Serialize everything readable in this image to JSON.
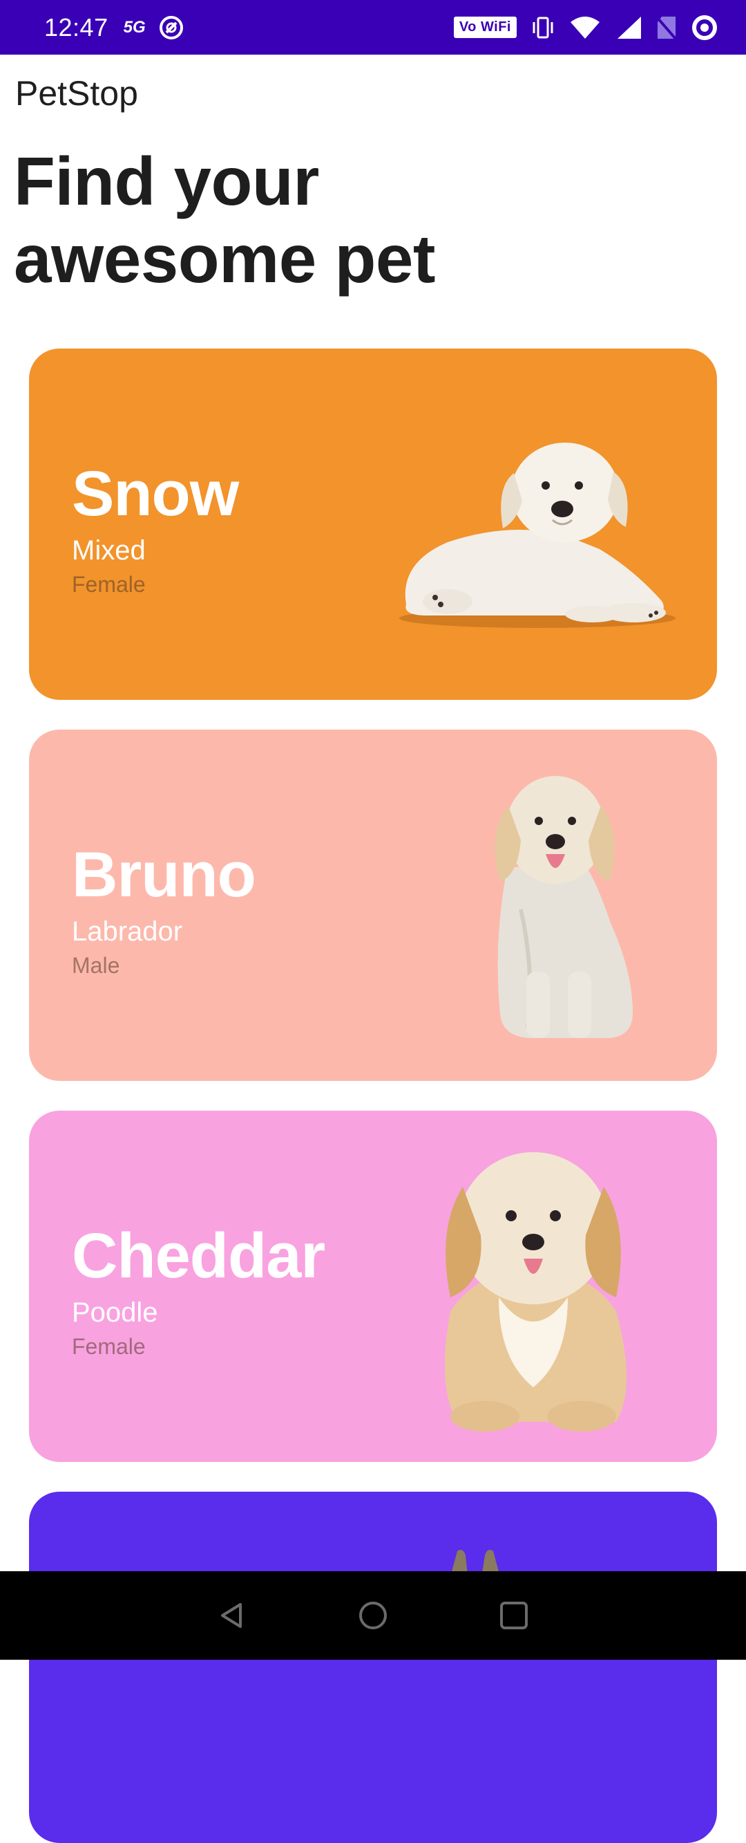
{
  "status_bar": {
    "time": "12:47",
    "network_label": "5G",
    "vowifi_label": "Vo WiFi"
  },
  "app": {
    "title": "PetStop",
    "heading_line1": "Find your",
    "heading_line2": "awesome pet"
  },
  "pets": [
    {
      "name": "Snow",
      "breed": "Mixed",
      "gender": "Female",
      "bg_color": "#f2932b",
      "image": "white-puppy-lying"
    },
    {
      "name": "Bruno",
      "breed": "Labrador",
      "gender": "Male",
      "bg_color": "#fdb8ac",
      "image": "golden-retriever-sitting"
    },
    {
      "name": "Cheddar",
      "breed": "Poodle",
      "gender": "Female",
      "bg_color": "#f9a2e0",
      "image": "fluffy-dog-sitting"
    },
    {
      "name": "",
      "breed": "",
      "gender": "",
      "bg_color": "#5a2cec",
      "image": "dog-ears-partial"
    }
  ],
  "nav": {
    "icons": [
      "back-icon",
      "home-icon",
      "recents-icon"
    ]
  }
}
